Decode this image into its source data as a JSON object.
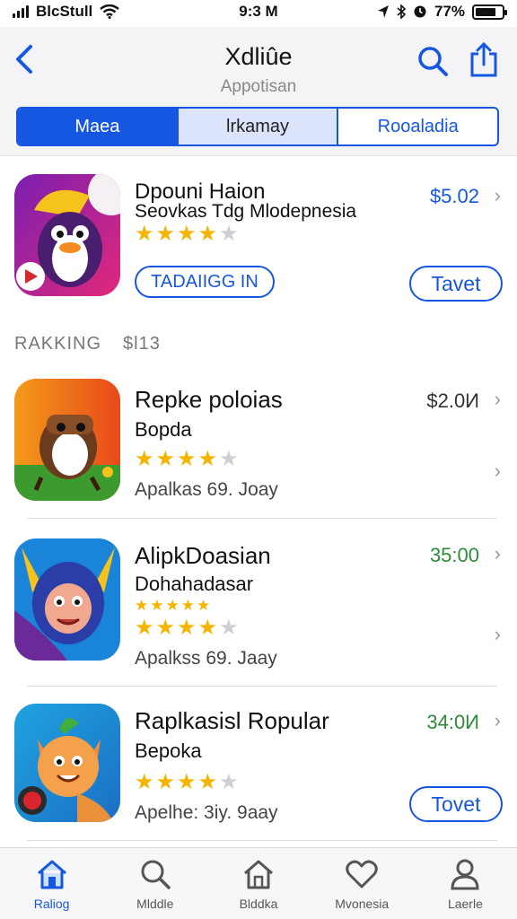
{
  "status_bar": {
    "carrier": "BlcStull",
    "time": "9:3 M",
    "battery": "77%",
    "battery_level": 0.77
  },
  "nav": {
    "back_icon": "chevron-left-icon",
    "title": "Xdliûe",
    "subtitle": "Appotisan",
    "search_icon": "search-icon",
    "share_icon": "share-icon"
  },
  "segments": [
    {
      "label": "Maea",
      "state": "selected"
    },
    {
      "label": "lrkamay",
      "state": "highlighted"
    },
    {
      "label": "Rooaladia",
      "state": "normal"
    }
  ],
  "featured": {
    "title": "Dpouni Haion",
    "subtitle": "Seovkas Tdg Mlodepnesia",
    "price": "$5.02",
    "rating": 4,
    "button_label": "TADAIIGG IN",
    "action_label": "Tavet"
  },
  "section": {
    "title": "RAKKING",
    "value": "$l13"
  },
  "apps": [
    {
      "title": "Repke poloias",
      "developer": "Bopda",
      "rating": 4,
      "meta": "Apalkas 69. Joay",
      "price": "$2.0И",
      "price_color": "#333333"
    },
    {
      "title": "AlipkDoasian",
      "developer": "Dohahadasar",
      "extra_rating": 5,
      "rating": 4,
      "meta": "Apalkss 69. Jaay",
      "price": "35:00",
      "price_color": "#2e8b3a"
    },
    {
      "title": "Raplkasisl Ropular",
      "developer": "Bepoka",
      "rating": 4,
      "meta": "Apelhe: 3iy. 9aay",
      "price": "34:0И",
      "price_color": "#2e8b3a",
      "action_label": "Tovet"
    }
  ],
  "tabbar": [
    {
      "label": "Raliog",
      "icon": "home-icon",
      "active": true
    },
    {
      "label": "Mlddle",
      "icon": "search-icon",
      "active": false
    },
    {
      "label": "Blddka",
      "icon": "store-icon",
      "active": false
    },
    {
      "label": "Mvonesia",
      "icon": "heart-icon",
      "active": false
    },
    {
      "label": "Laerle",
      "icon": "person-icon",
      "active": false
    }
  ],
  "colors": {
    "accent": "#1557e0",
    "star": "#f5b400",
    "green_price": "#2e8b3a"
  }
}
